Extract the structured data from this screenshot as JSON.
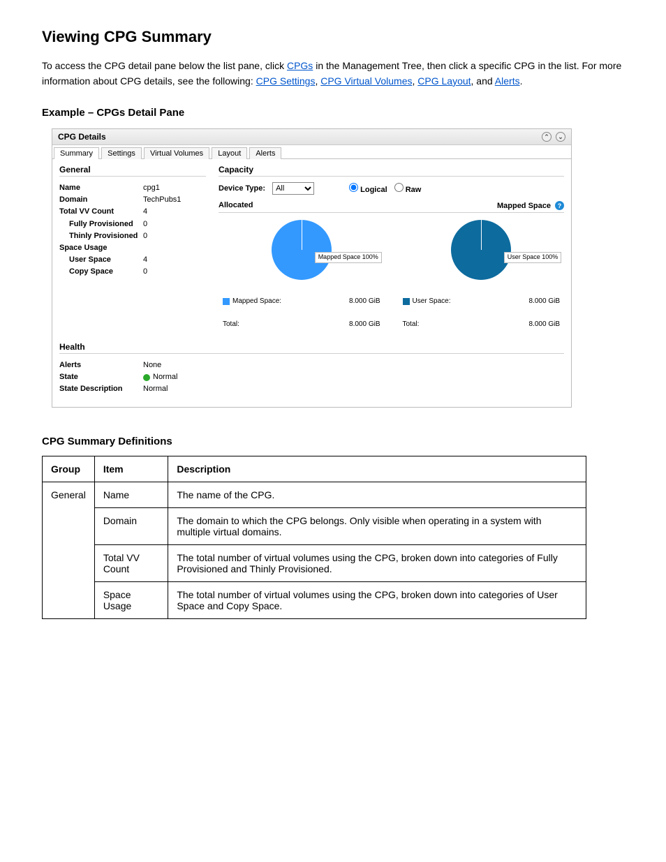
{
  "heading": "Viewing CPG Summary",
  "intro_text_parts": {
    "p1_a": "To access the CPG detail pane below the list pane, click ",
    "p1_b": " in the Management Tree, then click a specific CPG in the list. ",
    "p1_c": "For more information about CPG details, see the following: ",
    "link_cpgs": "CPGs",
    "link_settings": "CPG Settings",
    "link_vv": "CPG Virtual Volumes",
    "link_layout": "CPG Layout",
    "link_alerts": "Alerts",
    "p2": "."
  },
  "example_label": "Example – CPGs Detail Pane",
  "panel": {
    "title": "CPG Details",
    "tabs": [
      "Summary",
      "Settings",
      "Virtual Volumes",
      "Layout",
      "Alerts"
    ],
    "active_tab": 0,
    "general": {
      "header": "General",
      "rows": [
        {
          "k": "Name",
          "v": "cpg1",
          "bold": true
        },
        {
          "k": "Domain",
          "v": "TechPubs1",
          "bold": true
        },
        {
          "k": "Total VV Count",
          "v": "4",
          "bold": true
        },
        {
          "k": "Fully Provisioned",
          "v": "0",
          "indent": true
        },
        {
          "k": "Thinly Provisioned",
          "v": "0",
          "indent": true
        },
        {
          "k": "Space Usage",
          "v": "",
          "bold": true
        },
        {
          "k": "User Space",
          "v": "4",
          "indent": true
        },
        {
          "k": "Copy Space",
          "v": "0",
          "indent": true
        }
      ]
    },
    "capacity": {
      "header": "Capacity",
      "device_label": "Device Type:",
      "device_value": "All",
      "radios": {
        "logical": "Logical",
        "raw": "Raw",
        "selected": "logical"
      },
      "allocated_label": "Allocated",
      "mapped_label": "Mapped Space",
      "callout_a": "Mapped Space 100%",
      "callout_b": "User Space 100%",
      "legend_a": {
        "name": "Mapped Space:",
        "val": "8.000 GiB"
      },
      "legend_b": {
        "name": "User Space:",
        "val": "8.000 GiB"
      },
      "total_a": {
        "name": "Total:",
        "val": "8.000 GiB"
      },
      "total_b": {
        "name": "Total:",
        "val": "8.000 GiB"
      }
    },
    "health": {
      "header": "Health",
      "rows": [
        {
          "k": "Alerts",
          "v": "None"
        },
        {
          "k": "State",
          "v": "Normal",
          "dot": true
        },
        {
          "k": "State Description",
          "v": "Normal"
        }
      ]
    }
  },
  "chart_data": [
    {
      "type": "pie",
      "title": "Allocated",
      "series": [
        {
          "name": "Mapped Space",
          "values": [
            100
          ]
        }
      ],
      "total_gib": 8.0
    },
    {
      "type": "pie",
      "title": "Mapped Space",
      "series": [
        {
          "name": "User Space",
          "values": [
            100
          ]
        }
      ],
      "total_gib": 8.0
    }
  ],
  "deftable": {
    "caption": "CPG Summary Definitions",
    "head": [
      "Group",
      "Item",
      "Description"
    ],
    "rows": [
      {
        "group": "General",
        "item": "Name",
        "desc": "The name of the CPG.",
        "rowspan": 4
      },
      {
        "group": "",
        "item": "Domain",
        "desc": "The domain to which the CPG belongs. Only visible when operating in a system with multiple virtual domains."
      },
      {
        "group": "",
        "item": "Total VV Count",
        "desc": "The total number of virtual volumes using the CPG, broken down into categories of Fully Provisioned and Thinly Provisioned."
      },
      {
        "group": "",
        "item": "Space Usage",
        "desc": "The total number of virtual volumes using the CPG, broken down into categories of User Space and Copy Space."
      }
    ]
  }
}
